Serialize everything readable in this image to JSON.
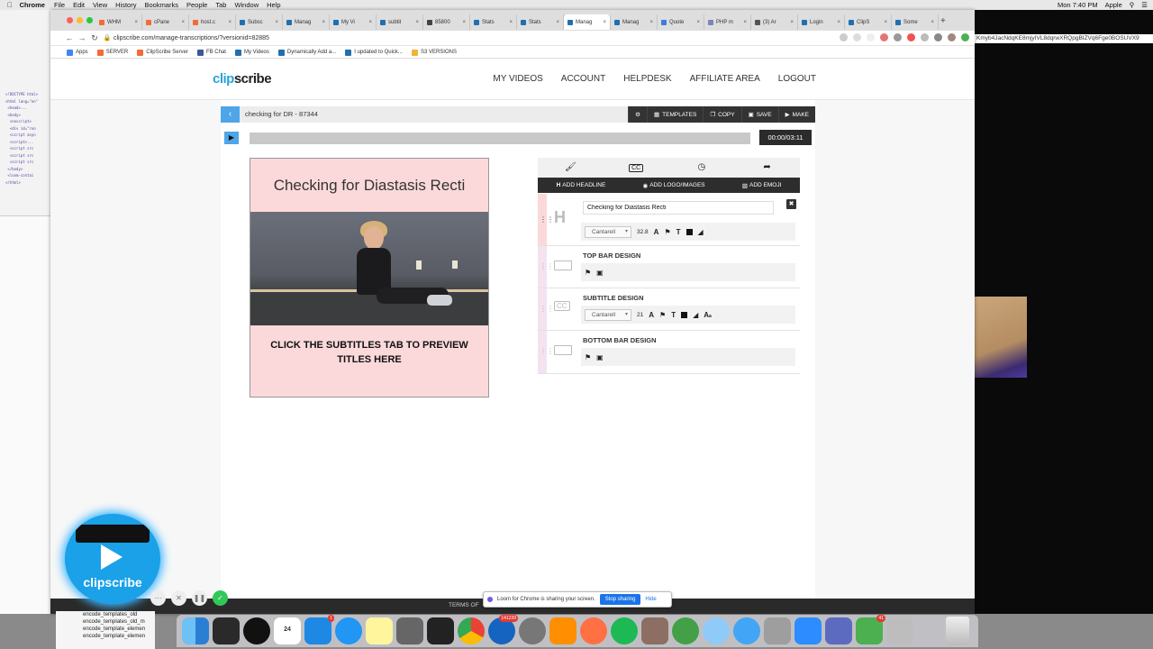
{
  "menubar": {
    "app_name": "Chrome",
    "items": [
      "File",
      "Edit",
      "View",
      "History",
      "Bookmarks",
      "People",
      "Tab",
      "Window",
      "Help"
    ],
    "clock": "Mon 7:40 PM",
    "user": "Apple"
  },
  "browser": {
    "tabs": [
      {
        "label": "WHM",
        "color": "#f26b38"
      },
      {
        "label": "cPane",
        "color": "#f26b38"
      },
      {
        "label": "host.c",
        "color": "#f26b38"
      },
      {
        "label": "Subsc",
        "color": "#1f6fb2"
      },
      {
        "label": "Manag",
        "color": "#1f6fb2"
      },
      {
        "label": "My Vi",
        "color": "#1f6fb2"
      },
      {
        "label": "subtit",
        "color": "#1f6fb2"
      },
      {
        "label": "85800",
        "color": "#444444"
      },
      {
        "label": "Stats",
        "color": "#1f6fb2"
      },
      {
        "label": "Stats",
        "color": "#1f6fb2"
      },
      {
        "label": "Manag",
        "color": "#1f6fb2",
        "active": true
      },
      {
        "label": "Manag",
        "color": "#1f6fb2"
      },
      {
        "label": "Quote",
        "color": "#3b7ddd"
      },
      {
        "label": "PHP m",
        "color": "#7a86b8"
      },
      {
        "label": "(3) Ar",
        "color": "#555555"
      },
      {
        "label": "Login",
        "color": "#1f6fb2"
      },
      {
        "label": "ClipS",
        "color": "#1f6fb2"
      },
      {
        "label": "Some",
        "color": "#1f6fb2"
      }
    ],
    "url": "clipscribe.com/manage-transcriptions/?versionid=82885",
    "bookmarks": [
      {
        "label": "Apps",
        "color": "#4285f4"
      },
      {
        "label": "SERVER",
        "color": "#f26b38"
      },
      {
        "label": "ClipScribe Server",
        "color": "#f26b38"
      },
      {
        "label": "FB Chat",
        "color": "#3b5998",
        "prefix": "FB"
      },
      {
        "label": "My Videos",
        "color": "#1f6fb2"
      },
      {
        "label": "Dynamically Add a...",
        "color": "#1f6fb2"
      },
      {
        "label": "I updated to Quick...",
        "color": "#1f6fb2"
      },
      {
        "label": "S3 VERSIONS",
        "color": "#f2b233"
      }
    ]
  },
  "site": {
    "logo_part1": "clip",
    "logo_part2": "scribe",
    "nav": [
      "MY VIDEOS",
      "ACCOUNT",
      "HELPDESK",
      "AFFILIATE AREA",
      "LOGOUT"
    ]
  },
  "project": {
    "title": "checking for DR - 87344",
    "toolbar": {
      "templates": "TEMPLATES",
      "copy": "COPY",
      "save": "SAVE",
      "make": "MAKE"
    },
    "timecode": "00:00/03:11",
    "progress": 0.0
  },
  "preview": {
    "headline": "Checking for Diastasis Recti",
    "bottom_text": "CLICK THE SUBTITLES TAB TO PREVIEW TITLES HERE"
  },
  "editor": {
    "actions": {
      "add_headline": "ADD HEADLINE",
      "add_logo": "ADD LOGO/IMAGES",
      "add_emoji": "ADD EMOJI"
    },
    "headline_layer": {
      "value": "Checking for Diastasis Recti",
      "font": "Cantarell",
      "size": "32.8"
    },
    "top_bar": {
      "name": "TOP BAR DESIGN"
    },
    "subtitle": {
      "name": "SUBTITLE DESIGN",
      "font": "Cantarell",
      "size": "21"
    },
    "bottom_bar": {
      "name": "BOTTOM BAR DESIGN"
    }
  },
  "right_bg": {
    "hash_text": "Kmyb4JacNdqKE8mjyIVL8dqrwXRQpgBIZVq6Fge0BOSUVX9"
  },
  "footer": {
    "terms": "TERMS OF"
  },
  "loom": {
    "message": "Loom for Chrome is sharing your screen.",
    "stop": "Stop sharing",
    "hide": "Hide",
    "bubble_text": "clipscribe"
  },
  "finder": {
    "files": [
      "encode_templates_old",
      "encode_templates_old_m",
      "encode_template_elemen",
      "encode_template_elemen"
    ]
  },
  "dock": {
    "calendar_day": "24",
    "badges": {
      "mail": "141239",
      "slack": "41"
    }
  },
  "colors": {
    "accent_blue": "#4ea6e8",
    "preview_pink": "#fbd9da",
    "toolbar_dark": "#333333",
    "logo_blue": "#2aa3d9"
  }
}
